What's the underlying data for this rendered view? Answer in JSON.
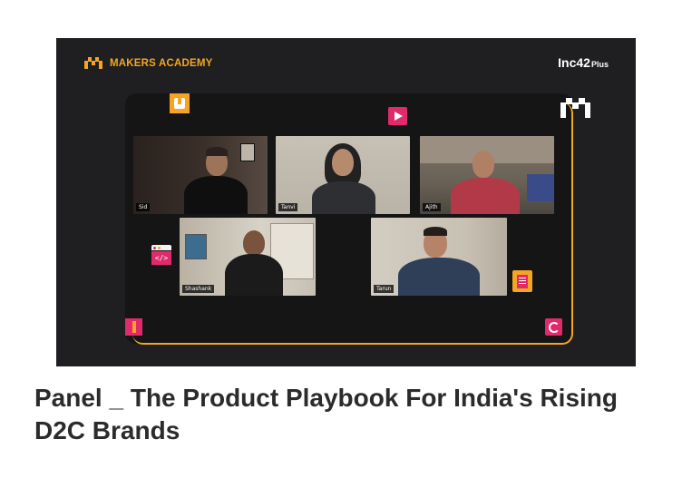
{
  "thumbnail": {
    "brand_name": "MAKERS ACADEMY",
    "partner_logo": "Inc42",
    "partner_logo_suffix": "Plus",
    "accent_color": "#f5a524",
    "background_color": "#1f1f21"
  },
  "participants": [
    {
      "name": "Sid"
    },
    {
      "name": "Tanvi"
    },
    {
      "name": "Ajith"
    },
    {
      "name": "Shashank"
    },
    {
      "name": "Tarun"
    }
  ],
  "decorations": {
    "icons": [
      "hand-pointer-icon",
      "play-icon",
      "code-icon",
      "clipboard-icon",
      "tool-icon",
      "refresh-icon",
      "makers-m-icon"
    ]
  },
  "video": {
    "title": "Panel _ The Product Playbook For India's Rising D2C Brands"
  }
}
